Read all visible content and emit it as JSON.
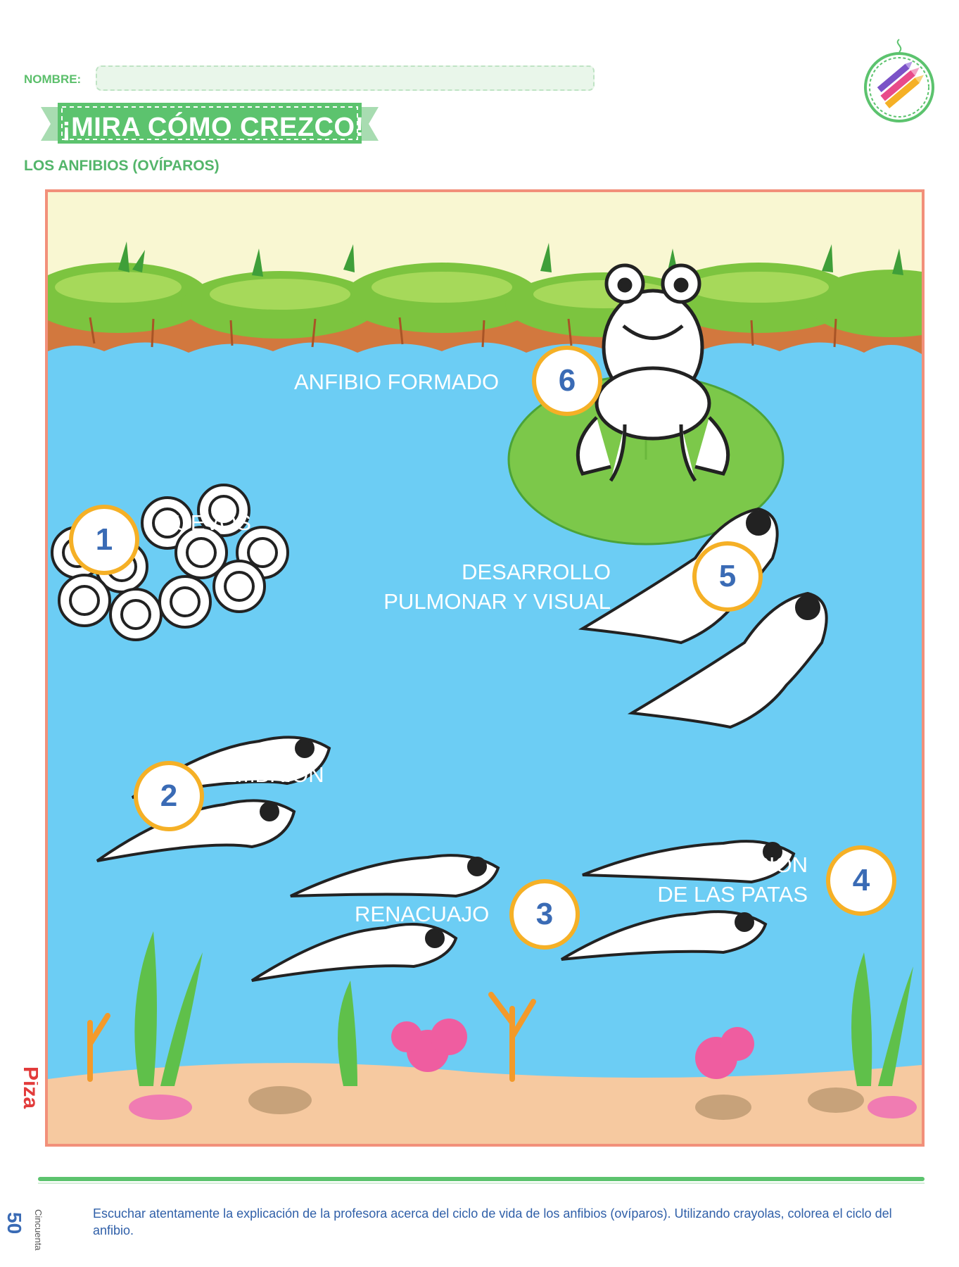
{
  "header": {
    "name_label": "NOMBRE:",
    "name_value": "",
    "title": "¡MIRA CÓMO CREZCO!",
    "subtitle": "LOS ANFIBIOS (OVÍPAROS)",
    "badge_icon": "crayons-icon"
  },
  "stages": [
    {
      "number": "1",
      "label": "HUEVOS"
    },
    {
      "number": "2",
      "label": "EMBRIÓN"
    },
    {
      "number": "3",
      "label": "RENACUAJO"
    },
    {
      "number": "4",
      "label_line1": "APARICIÓN",
      "label_line2": "DE LAS PATAS"
    },
    {
      "number": "5",
      "label_line1": "DESARROLLO",
      "label_line2": "PULMONAR Y VISUAL"
    },
    {
      "number": "6",
      "label": "ANFIBIO FORMADO"
    }
  ],
  "colors": {
    "accent_green": "#5cc36e",
    "water": "#6ccdf4",
    "sky": "#f9f7d2",
    "number_ring": "#f5b026",
    "number_text": "#3a6bb5",
    "frame": "#f2907a"
  },
  "footer": {
    "page_number": "50",
    "page_word": "Cincuenta",
    "publisher": "Piza ediciones",
    "instructions": "Escuchar atentamente la explicación de la profesora acerca del ciclo de vida de los anfibios (ovíparos). Utilizando crayolas, colorea el ciclo del anfibio."
  }
}
